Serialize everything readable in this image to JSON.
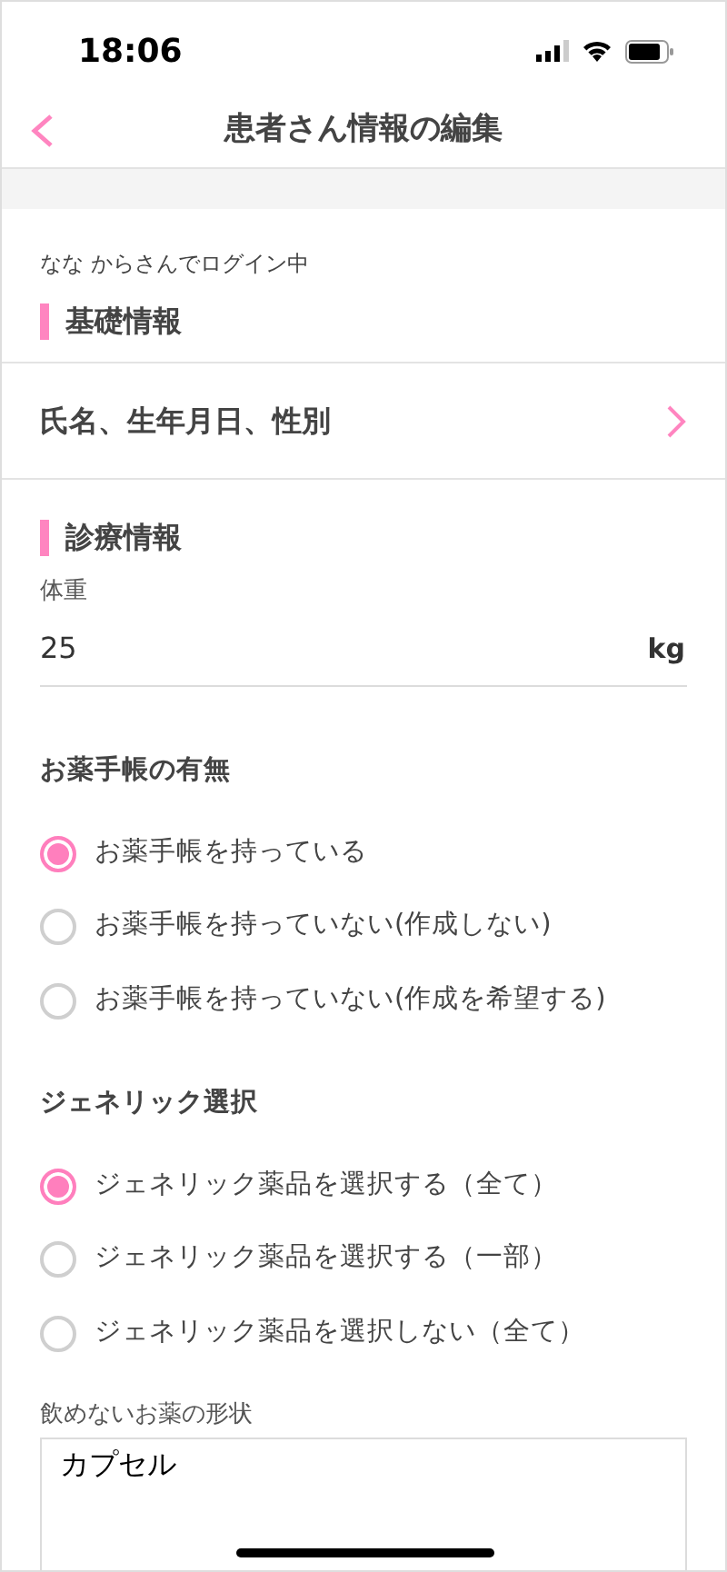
{
  "status_bar": {
    "time": "18:06"
  },
  "nav": {
    "title": "患者さん情報の編集"
  },
  "login_text": "なな からさんでログイン中",
  "basic": {
    "heading": "基礎情報",
    "link": "氏名、生年月日、性別"
  },
  "medical": {
    "heading": "診療情報",
    "weight": {
      "label": "体重",
      "value": "25",
      "unit": "kg"
    },
    "groups": [
      {
        "heading": "お薬手帳の有無",
        "options": [
          {
            "label": "お薬手帳を持っている",
            "selected": true
          },
          {
            "label": "お薬手帳を持っていない(作成しない)",
            "selected": false
          },
          {
            "label": "お薬手帳を持っていない(作成を希望する)",
            "selected": false
          }
        ]
      },
      {
        "heading": "ジェネリック選択",
        "options": [
          {
            "label": "ジェネリック薬品を選択する（全て）",
            "selected": true
          },
          {
            "label": "ジェネリック薬品を選択する（一部）",
            "selected": false
          },
          {
            "label": "ジェネリック薬品を選択しない（全て）",
            "selected": false
          }
        ]
      }
    ],
    "form_field": {
      "label": "飲めないお薬の形状",
      "value": "カプセル"
    }
  }
}
